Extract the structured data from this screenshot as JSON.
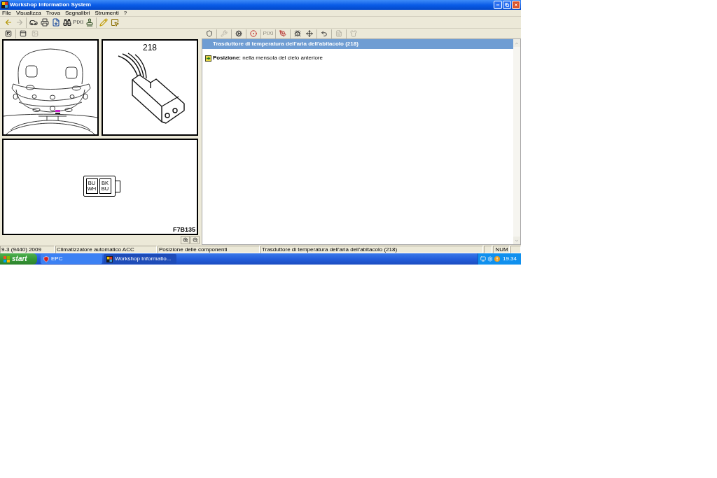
{
  "window": {
    "title": "Workshop Information System"
  },
  "menu": [
    {
      "label": "File"
    },
    {
      "label": "Visualizza"
    },
    {
      "label": "Trova"
    },
    {
      "label": "Segnalibri"
    },
    {
      "label": "Strumenti"
    },
    {
      "label": "?"
    }
  ],
  "main_toolbar": [
    [
      {
        "disabled": false
      },
      {
        "disabled": true
      }
    ],
    [
      {
        "disabled": false
      },
      {
        "disabled": false
      },
      {
        "disabled": false
      },
      {
        "disabled": false
      },
      {
        "label": "PIXI",
        "disabled": false
      },
      {
        "disabled": false
      }
    ],
    [
      {
        "disabled": false
      },
      {
        "disabled": false
      }
    ]
  ],
  "view_toolbar": [
    [
      {
        "disabled": false
      }
    ],
    [
      {
        "disabled": false
      },
      {
        "disabled": true
      }
    ]
  ],
  "document_toolbar": [
    [
      {
        "disabled": false
      }
    ],
    [
      {
        "disabled": true
      }
    ],
    [
      {
        "disabled": false
      }
    ],
    [
      {
        "disabled": false
      }
    ],
    [
      {
        "label": "PIXI",
        "disabled": true
      }
    ],
    [
      {
        "disabled": false
      }
    ],
    [
      {
        "disabled": false
      },
      {
        "disabled": false
      }
    ],
    [
      {
        "disabled": false
      }
    ],
    [
      {
        "disabled": true
      }
    ],
    [
      {
        "disabled": true
      }
    ]
  ],
  "illustrations": {
    "connector_number": "218",
    "pinout": [
      {
        "wire": "BU WH"
      },
      {
        "wire": "BK BU"
      }
    ],
    "figure_code": "F7B135"
  },
  "document": {
    "heading": "Trasduttore di temperatura dell'aria dell'abitacolo (218)",
    "position": "**Posizione:** nella mensola del cielo anteriore"
  },
  "status_bar": [
    {
      "text": "9-3 (9440) 2009"
    },
    {
      "text": "Climatizzatore automatico ACC"
    },
    {
      "text": "Posizione delle componenti"
    },
    {
      "text": "Trasduttore di temperatura dell'aria dell'abitacolo (218)"
    },
    {
      "text": "NUM"
    }
  ],
  "taskbar": {
    "start": "start",
    "tasks": [
      {
        "label": "EPC",
        "selected": false
      },
      {
        "label": "Workshop Informatio...",
        "selected": true
      }
    ],
    "clock": "19.34"
  }
}
